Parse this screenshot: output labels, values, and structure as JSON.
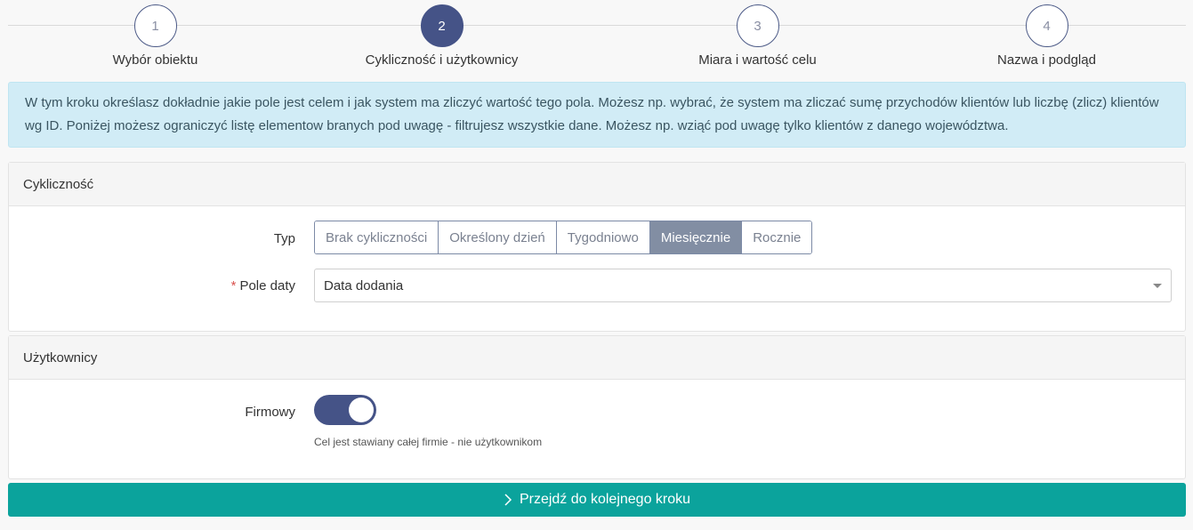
{
  "stepper": {
    "steps": [
      {
        "number": "1",
        "label": "Wybór obiektu"
      },
      {
        "number": "2",
        "label": "Cykliczność i użytkownicy"
      },
      {
        "number": "3",
        "label": "Miara i wartość celu"
      },
      {
        "number": "4",
        "label": "Nazwa i podgląd"
      }
    ],
    "active_index": 1
  },
  "info": {
    "text": "W tym kroku określasz dokładnie jakie pole jest celem i jak system ma zliczyć wartość tego pola. Możesz np. wybrać, że system ma zliczać sumę przychodów klientów lub liczbę (zlicz) klientów wg ID. Poniżej możesz ograniczyć listę elementow branych pod uwagę - filtrujesz wszystkie dane. Możesz np. wziąć pod uwagę tylko klientów z danego województwa."
  },
  "cyclicity": {
    "title": "Cykliczność",
    "type_label": "Typ",
    "options": [
      "Brak cykliczności",
      "Określony dzień",
      "Tygodniowo",
      "Miesięcznie",
      "Rocznie"
    ],
    "selected": "Miesięcznie",
    "required_mark": "*",
    "date_field_label": "Pole daty",
    "date_field_value": "Data dodania"
  },
  "users": {
    "title": "Użytkownicy",
    "company_label": "Firmowy",
    "company_toggle_on": true,
    "help_text": "Cel jest stawiany całej firmie - nie użytkownikom"
  },
  "next_button": {
    "label": "Przejdź do kolejnego kroku",
    "icon": "chevron-right-icon"
  },
  "colors": {
    "primary": "#455387",
    "info_bg": "#d1ecf6",
    "action": "#0ba39c",
    "selected_option": "#828ea3"
  }
}
